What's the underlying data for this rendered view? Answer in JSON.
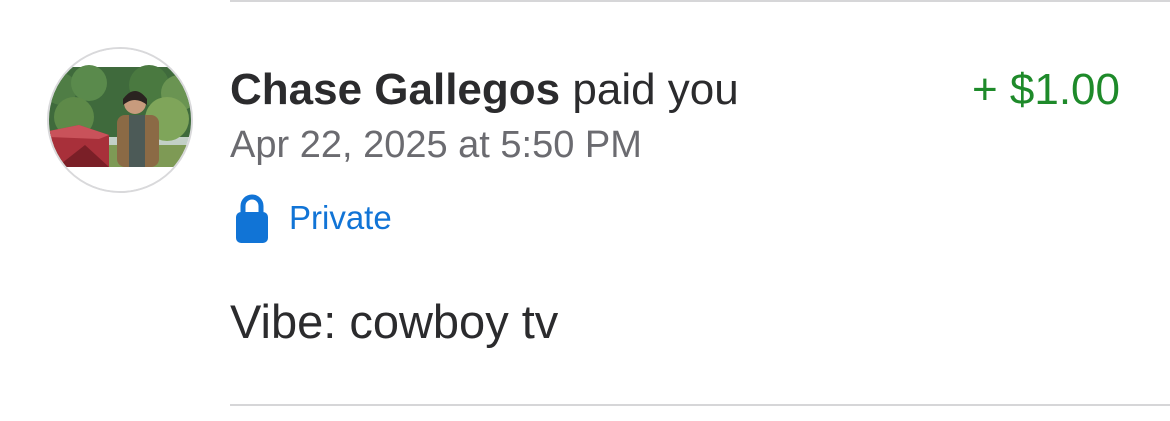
{
  "transaction": {
    "avatar_icon": "profile-photo",
    "sender_name": "Chase Gallegos",
    "action": "paid you",
    "amount": "+ $1.00",
    "amount_color": "#1e8a2a",
    "datetime": "Apr 22, 2025 at 5:50 PM",
    "privacy": {
      "icon": "lock-icon",
      "label": "Private",
      "color": "#1174d6"
    },
    "note": "Vibe: cowboy tv"
  }
}
